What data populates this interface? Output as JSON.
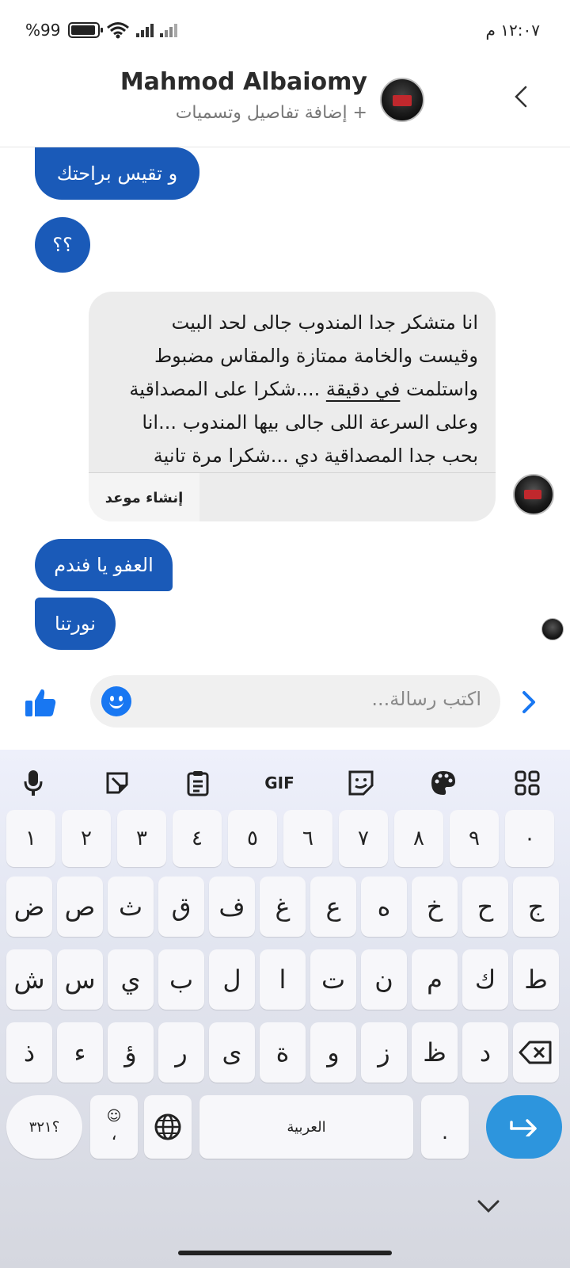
{
  "status_bar": {
    "battery_text": "%99",
    "time": "١٢:٠٧ م"
  },
  "header": {
    "name": "Mahmod Albaiomy",
    "subtitle": "+ إضافة تفاصيل وتسميات"
  },
  "messages": {
    "out1": "و تقيس براحتك",
    "out2": "؟؟",
    "incoming_text_before": "انا متشكر جدا المندوب جالى لحد البيت\nوقيست والخامة ممتازة والمقاس مضبوط\nواستلمت ",
    "incoming_underlined": "في دقيقة",
    "incoming_text_after": " ....شكرا على المصداقية\nوعلى السرعة اللى جالى بيها المندوب ...انا\nبحب جدا المصداقية دي ...شكرا مرة تانية",
    "incoming_action": "إنشاء موعد",
    "out3": "العفو يا فندم",
    "out4": "نورتنا"
  },
  "composer": {
    "placeholder": "اكتب رسالة..."
  },
  "keyboard": {
    "toolbar": [
      "mic-icon",
      "sticker-edit-icon",
      "clipboard-icon",
      "GIF",
      "emoji-sticker-icon",
      "palette-icon",
      "apps-grid-icon"
    ],
    "gif_label": "GIF",
    "row_numbers": [
      "١",
      "٢",
      "٣",
      "٤",
      "٥",
      "٦",
      "٧",
      "٨",
      "٩",
      "٠"
    ],
    "row1": [
      "ض",
      "ص",
      "ث",
      "ق",
      "ف",
      "غ",
      "ع",
      "ه",
      "خ",
      "ح",
      "ج"
    ],
    "row2": [
      "ش",
      "س",
      "ي",
      "ب",
      "ل",
      "ا",
      "ت",
      "ن",
      "م",
      "ك",
      "ط"
    ],
    "row3": [
      "ذ",
      "ء",
      "ؤ",
      "ر",
      "ى",
      "ة",
      "و",
      "ز",
      "ظ",
      "د"
    ],
    "symbols_label": "؟٣٢١",
    "comma": "،",
    "space_label": "العربية",
    "period": "."
  },
  "colors": {
    "brand_blue": "#1a5ab8",
    "messenger_blue": "#1877f2",
    "enter_blue": "#2d95dd"
  }
}
